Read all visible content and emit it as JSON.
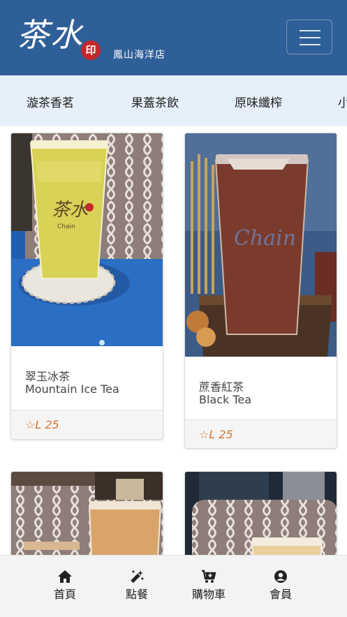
{
  "header": {
    "logo_text": "茶水",
    "logo_seal": "印",
    "store_name": "鳳山海洋店",
    "menu_icon": "hamburger-menu-icon",
    "color": "#2f5f98"
  },
  "tabs": [
    "漩茶香茗",
    "果蓋茶飲",
    "原味纖榨",
    "小"
  ],
  "products": [
    {
      "name_zh": "翠玉冰茶",
      "name_en": "Mountain Ice Tea",
      "price": "☆L 25"
    },
    {
      "name_zh": "蔗香紅茶",
      "name_en": "Black Tea",
      "price": "☆L 25"
    }
  ],
  "cup_print": {
    "brand_zh": "茶水",
    "brand_en": "Chain"
  },
  "bottom_nav": [
    {
      "label": "首頁",
      "icon": "home-icon"
    },
    {
      "label": "點餐",
      "icon": "magic-wand-icon"
    },
    {
      "label": "購物車",
      "icon": "cart-icon"
    },
    {
      "label": "會員",
      "icon": "user-circle-icon"
    }
  ],
  "colors": {
    "price": "#d9742b",
    "tab_bar": "#e6f0fb",
    "accent": "#2f5f98"
  }
}
